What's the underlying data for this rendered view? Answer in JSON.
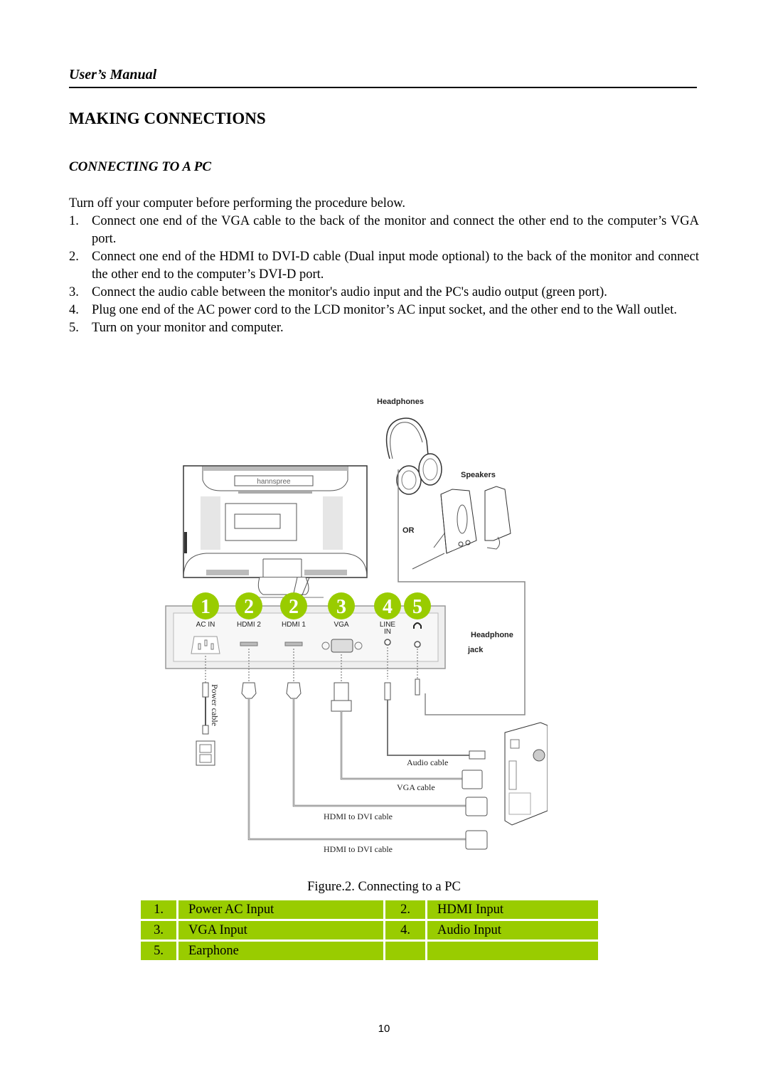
{
  "header": {
    "title": "User’s Manual"
  },
  "section_title": "MAKING CONNECTIONS",
  "subsection_title": "CONNECTING TO A PC",
  "intro": "Turn off your computer before performing the procedure below.",
  "steps": [
    {
      "num": "1.",
      "text": "Connect one end of the VGA cable to the back of the monitor and connect the other end to the computer’s VGA port."
    },
    {
      "num": "2.",
      "text": "Connect one end of the HDMI to DVI-D cable (Dual input mode optional) to the back of the monitor and connect the other end to the computer’s DVI-D port."
    },
    {
      "num": "3.",
      "text": "Connect the audio cable between the monitor's audio input and the PC's audio output (green port)."
    },
    {
      "num": "4.",
      "text": "Plug one end of the AC power cord to the LCD monitor’s AC input socket, and the other end to the Wall outlet."
    },
    {
      "num": "5.",
      "text": "Turn on your monitor and computer."
    }
  ],
  "figure": {
    "brand": "hannspree",
    "labels": {
      "headphones": "Headphones",
      "speakers": "Speakers",
      "or": "OR",
      "headphone_jack_1": "Headphone",
      "headphone_jack_2": "jack",
      "power_cable": "Power cable",
      "audio_cable": "Audio cable",
      "vga_cable": "VGA cable",
      "hdmi_dvi_1": "HDMI to DVI cable",
      "hdmi_dvi_2": "HDMI to DVI cable"
    },
    "ports": [
      {
        "badge": "1",
        "label": "AC IN"
      },
      {
        "badge": "2",
        "label": "HDMI 2"
      },
      {
        "badge": "2",
        "label": "HDMI 1"
      },
      {
        "badge": "3",
        "label": "VGA"
      },
      {
        "badge": "4",
        "label": "LINE",
        "label2": "IN"
      },
      {
        "badge": "5",
        "label": "headphone-icon"
      }
    ],
    "badge_color": "#99cc00",
    "caption": "Figure.2. Connecting to a PC"
  },
  "legend": {
    "rows": [
      [
        {
          "num": "1.",
          "text": "Power AC Input"
        },
        {
          "num": "2.",
          "text": "HDMI Input"
        }
      ],
      [
        {
          "num": "3.",
          "text": "VGA Input"
        },
        {
          "num": "4.",
          "text": "Audio Input"
        }
      ],
      [
        {
          "num": "5.",
          "text": "Earphone"
        },
        {
          "num": "",
          "text": ""
        }
      ]
    ],
    "cell_color": "#99cc00"
  },
  "page_number": "10"
}
